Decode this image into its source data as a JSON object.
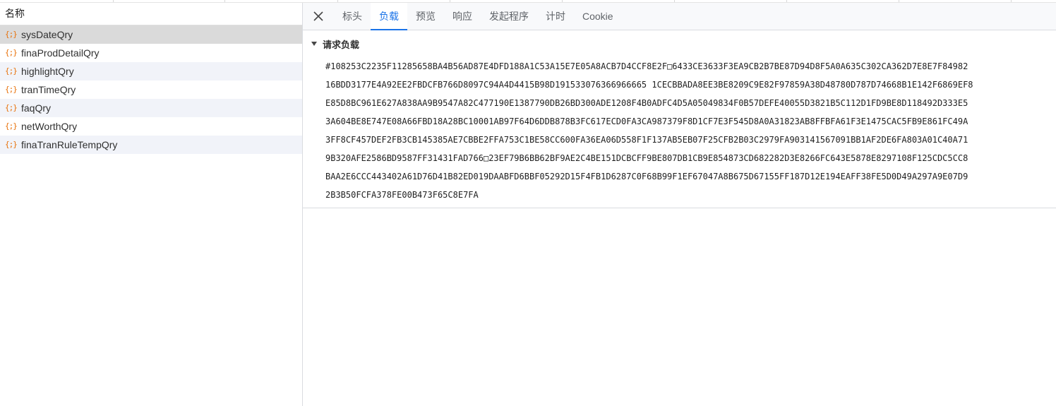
{
  "left": {
    "header": "名称",
    "icon_glyph": "{;}",
    "items": [
      {
        "label": "sysDateQry",
        "state": "selected"
      },
      {
        "label": "finaProdDetailQry",
        "state": "normal"
      },
      {
        "label": "highlightQry",
        "state": "alt"
      },
      {
        "label": "tranTimeQry",
        "state": "normal"
      },
      {
        "label": "faqQry",
        "state": "alt"
      },
      {
        "label": "netWorthQry",
        "state": "normal"
      },
      {
        "label": "finaTranRuleTempQry",
        "state": "alt"
      }
    ]
  },
  "tabs": [
    {
      "label": "标头",
      "active": false
    },
    {
      "label": "负载",
      "active": true
    },
    {
      "label": "预览",
      "active": false
    },
    {
      "label": "响应",
      "active": false
    },
    {
      "label": "发起程序",
      "active": false
    },
    {
      "label": "计时",
      "active": false
    },
    {
      "label": "Cookie",
      "active": false
    }
  ],
  "payload": {
    "title": "请求负载",
    "lines": [
      "#108253C2235F11285658BA4B56AD87E4DFD188A1C53A15E7E05A8ACB7D4CCF8E2F□6433CE3633F3EA9CB2B7BE87D94D8F5A0A635C302CA362D7E8E7F84982",
      "16BDD3177E4A92EE2FBDCFB766D8097C94A4D4415B98D191533076366966665 1CECBBADA8EE3BE8209C9E82F97859A38D48780D787D74668B1E142F6869EF8",
      "E85D8BC961E627A838AA9B9547A82C477190E1387790DB26BD300ADE1208F4B0ADFC4D5A05049834F0B57DEFE40055D3821B5C112D1FD9BE8D118492D333E5",
      "3A604BE8E747E08A66FBD18A28BC10001AB97F64D6DDB878B3FC617ECD0FA3CA987379F8D1CF7E3F545D8A0A31823AB8FFBFA61F3E1475CAC5FB9E861FC49A",
      "3FF8CF457DEF2FB3CB145385AE7CBBE2FFA753C1BE58CC600FA36EA06D558F1F137AB5EB07F25CFB2B03C2979FA903141567091BB1AF2DE6FA803A01C40A71",
      "9B320AFE2586BD9587FF31431FAD766□23EF79B6BB62BF9AE2C4BE151DCBCFF9BE807DB1CB9E854873CD682282D3E8266FC643E5878E8297108F125CDC5CC8",
      "BAA2E6CCC443402A61D76D41B82ED019DAABFD6BBF05292D15F4FB1D6287C0F68B99F1EF67047A8B675D67155FF187D12E194EAFF38FE5D0D49A297A9E07D9",
      "2B3B50FCFA378FE00B473F65C8E7FA"
    ]
  }
}
